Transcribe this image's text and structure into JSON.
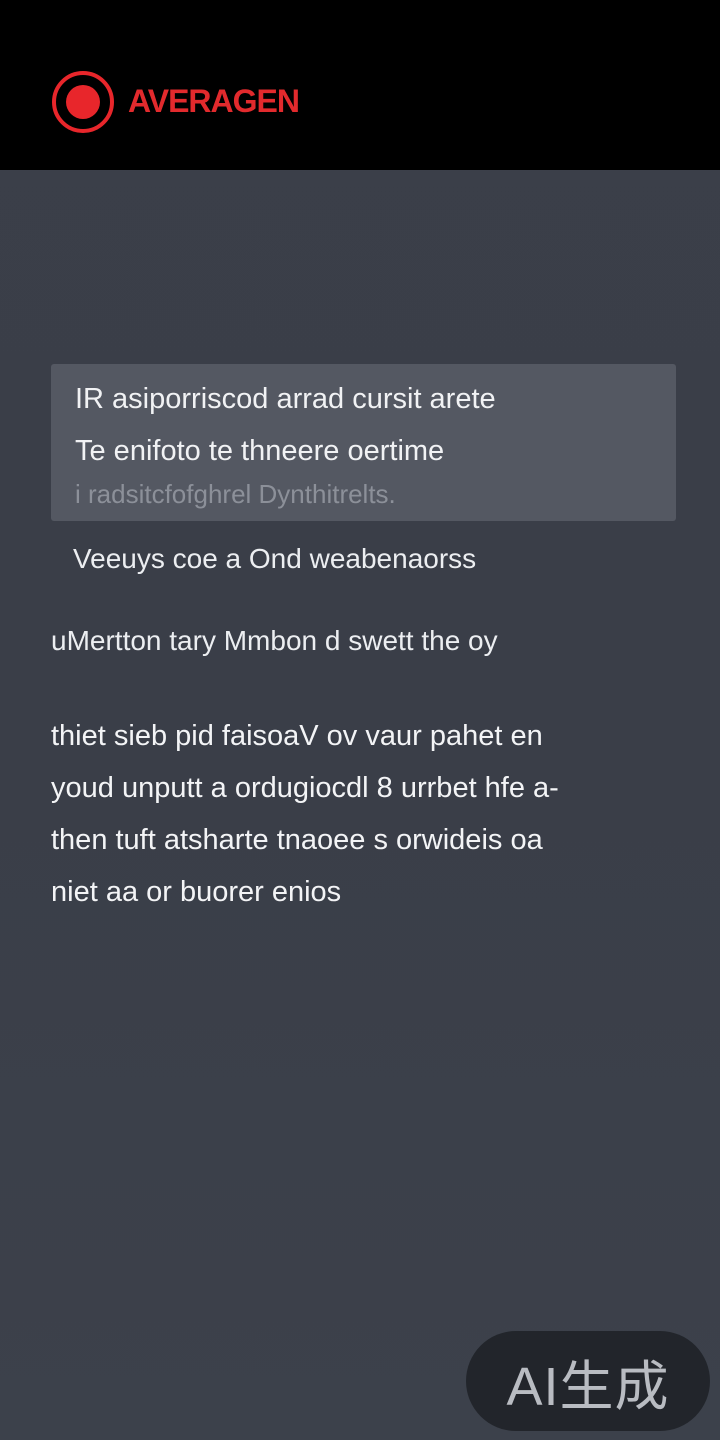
{
  "header": {
    "app_title": "AVERAGEN",
    "logo_icon": "record-icon",
    "accent_color": "#e8262b"
  },
  "card": {
    "line1": "IR asiporriscod   arrad cursit arete",
    "line2": "Te enifoto te thneere oertime",
    "line3": "i radsitcfofghrel  Dynthitrelts."
  },
  "subheading": "Veeuys coe a Ond weabenaorss",
  "tagline": "uMertton tary Mmbon d  swett the oy",
  "paragraph": [
    "thiet sieb pid faisoaV ov vaur pahet en",
    "youd unputt a ordugiocdl 8 urrbet hfe a-",
    "then tuft atsharte tnaoee s orwideis oa",
    "niet aa  or buorer enios"
  ],
  "badge": {
    "label": "AI生成"
  }
}
